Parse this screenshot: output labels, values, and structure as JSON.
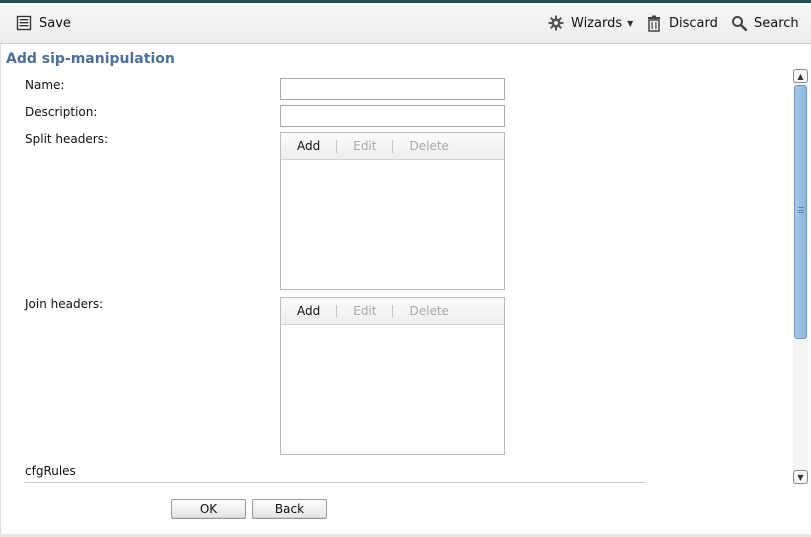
{
  "toolbar": {
    "save_label": "Save",
    "wizards_label": "Wizards",
    "discard_label": "Discard",
    "search_label": "Search"
  },
  "page": {
    "title": "Add sip-manipulation"
  },
  "form": {
    "name_label": "Name:",
    "name_value": "",
    "description_label": "Description:",
    "description_value": "",
    "split_headers_label": "Split headers:",
    "join_headers_label": "Join headers:",
    "list_actions": {
      "add": "Add",
      "edit": "Edit",
      "delete": "Delete"
    },
    "cfg_rules_label": "cfgRules"
  },
  "buttons": {
    "ok": "OK",
    "back": "Back"
  },
  "icons": {
    "save": "save-icon",
    "wizards": "gear-icon",
    "discard": "trash-icon",
    "search": "search-icon"
  },
  "colors": {
    "title": "#4d6f9a",
    "top_accent": "#1f4f5b",
    "scroll_thumb": "#8db4dc"
  }
}
